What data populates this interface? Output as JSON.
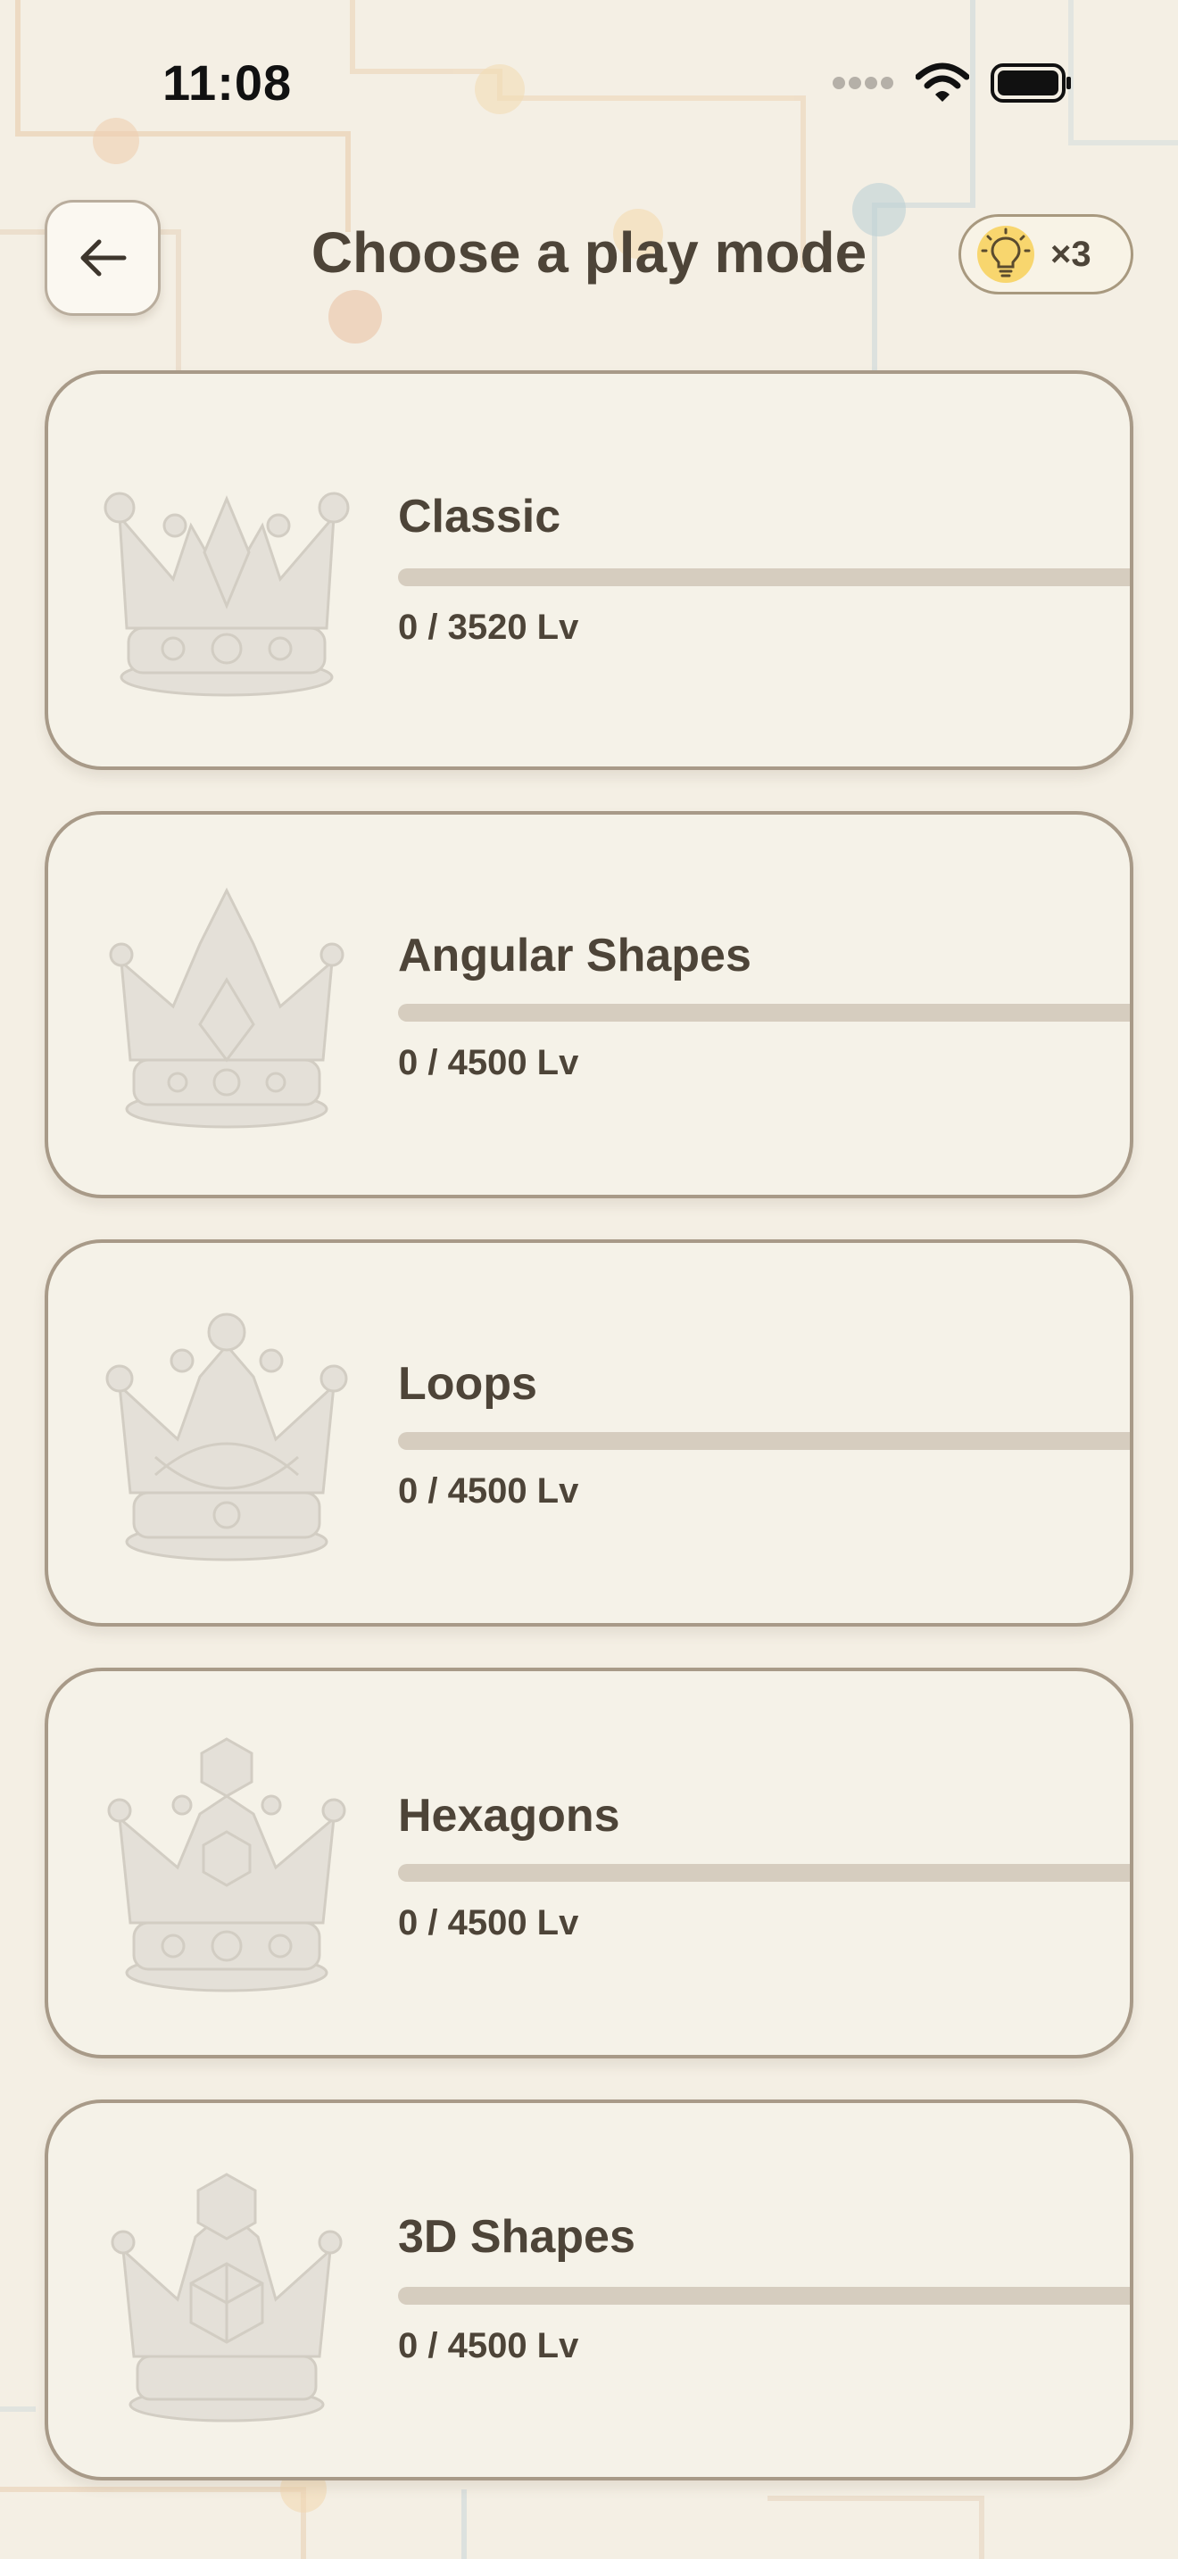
{
  "status_bar": {
    "time": "11:08",
    "icons": [
      "signal-dots-icon",
      "wifi-icon",
      "battery-icon"
    ]
  },
  "header": {
    "back_icon": "arrow-left-icon",
    "title": "Choose a play mode",
    "hint_icon": "lightbulb-icon",
    "hint_count": "×3"
  },
  "modes": [
    {
      "name": "Classic",
      "levels": "0 / 3520 Lv",
      "progress": 0,
      "crown": "classic-crown"
    },
    {
      "name": "Angular Shapes",
      "levels": "0 / 4500 Lv",
      "progress": 0,
      "crown": "angular-crown"
    },
    {
      "name": "Loops",
      "levels": "0 / 4500 Lv",
      "progress": 0,
      "crown": "loops-crown"
    },
    {
      "name": "Hexagons",
      "levels": "0 / 4500 Lv",
      "progress": 0,
      "crown": "hexagon-crown"
    },
    {
      "name": "3D Shapes",
      "levels": "0 / 4500 Lv",
      "progress": 0,
      "crown": "3d-crown"
    }
  ],
  "colors": {
    "background": "#f4efe4",
    "card": "#f5f2e8",
    "card_border": "#a89a88",
    "text": "#4d4438",
    "progress_track": "#d6cdbf",
    "hint_yellow": "#f8d66e"
  }
}
